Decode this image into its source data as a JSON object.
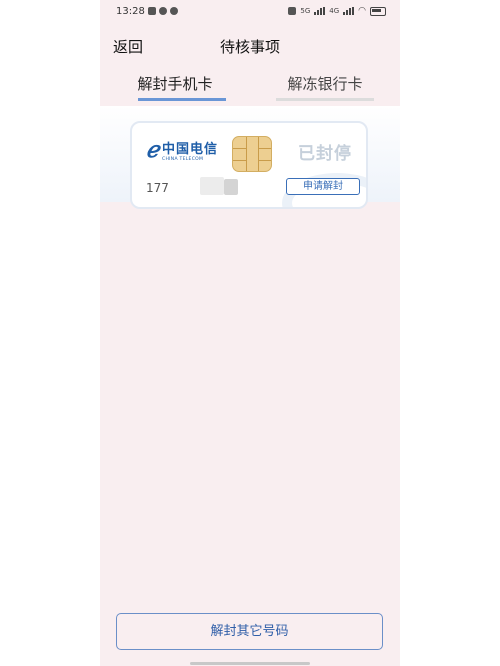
{
  "status_bar": {
    "time": "13:28",
    "network_labels": [
      "5G",
      "4G"
    ],
    "icons": [
      "app-icon",
      "check-icon",
      "wechat-icon",
      "nfc-icon",
      "signal-icon",
      "wifi-icon",
      "battery-icon"
    ]
  },
  "header": {
    "back_label": "返回",
    "title": "待核事项"
  },
  "tabs": [
    {
      "label": "解封手机卡",
      "active": true
    },
    {
      "label": "解冻银行卡",
      "active": false
    }
  ],
  "card": {
    "carrier_name_cn": "中国电信",
    "carrier_name_en": "CHINA TELECOM",
    "status": "已封停",
    "number_prefix": "177",
    "action_label": "申请解封"
  },
  "footer": {
    "button_label": "解封其它号码"
  },
  "colors": {
    "accent": "#3a6fb8",
    "tab_indicator": "#6a96d6",
    "background": "#f9eef0",
    "chip": "#edcf91"
  }
}
